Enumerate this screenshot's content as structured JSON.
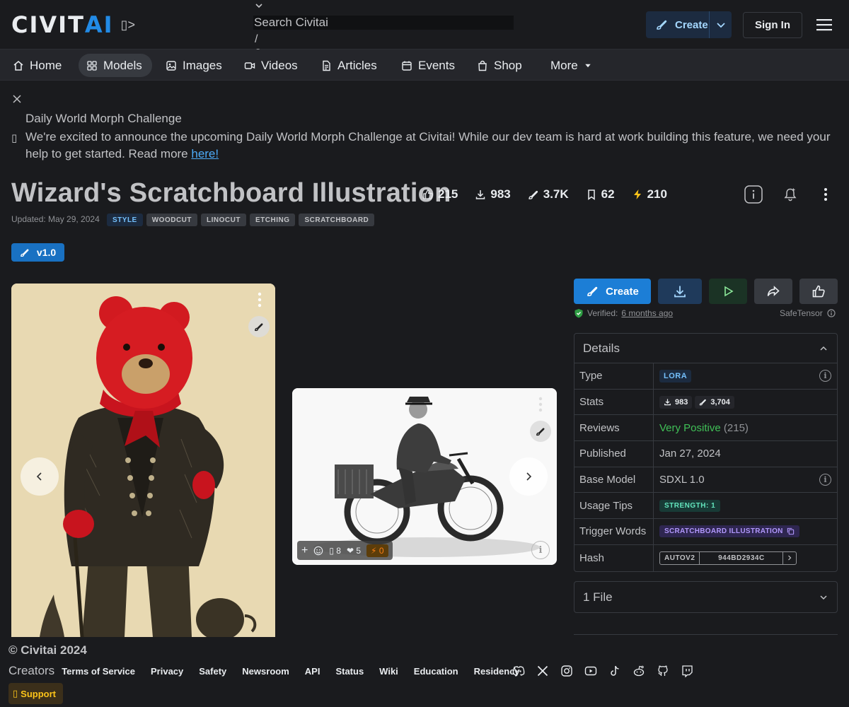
{
  "header": {
    "logo_left": "CIVIT",
    "logo_right": "AI",
    "logo_extra": "▯>",
    "search_placeholder": "Search Civitai",
    "search_hotkey": "/",
    "create_label": "Create",
    "signin_label": "Sign In"
  },
  "nav": {
    "items": [
      {
        "label": "Home",
        "icon": "home-icon"
      },
      {
        "label": "Models",
        "icon": "grid-icon"
      },
      {
        "label": "Images",
        "icon": "image-icon"
      },
      {
        "label": "Videos",
        "icon": "video-icon"
      },
      {
        "label": "Articles",
        "icon": "article-icon"
      },
      {
        "label": "Events",
        "icon": "calendar-icon"
      },
      {
        "label": "Shop",
        "icon": "shopping-bag-icon"
      },
      {
        "label": "More",
        "icon": "caret-down-icon"
      }
    ],
    "active": "Models"
  },
  "announcement": {
    "title": "Daily World Morph Challenge",
    "icon_glyph": "▯",
    "body": "We're excited to announce the upcoming Daily World Morph Challenge at Civitai! While our dev team is hard at work building this feature, we need your help to get started. Read more ",
    "link": "here!"
  },
  "model": {
    "title": "Wizard's Scratchboard Illustration",
    "stats": {
      "likes": "215",
      "downloads": "983",
      "generations": "3.7K",
      "bookmarks": "62",
      "buzz": "210"
    },
    "updated": "Updated: May 29, 2024",
    "tags": [
      "STYLE",
      "WOODCUT",
      "LINOCUT",
      "ETCHING",
      "SCRATCHBOARD"
    ],
    "version": "v1.0"
  },
  "gallery": {
    "card2_reactions": {
      "plus": "+",
      "comments": "8",
      "hearts": "5",
      "buzz": "0"
    }
  },
  "actions": {
    "create_label": "Create",
    "verified_prefix": "Verified:",
    "verified_time": "6 months ago",
    "safetensor": "SafeTensor"
  },
  "details": {
    "header": "Details",
    "type_label": "Type",
    "type_value": "LORA",
    "stats_label": "Stats",
    "stats_downloads": "983",
    "stats_generations": "3,704",
    "reviews_label": "Reviews",
    "reviews_sentiment": "Very Positive",
    "reviews_count": "(215)",
    "published_label": "Published",
    "published_value": "Jan 27, 2024",
    "base_label": "Base Model",
    "base_value": "SDXL 1.0",
    "tips_label": "Usage Tips",
    "tips_value": "STRENGTH: 1",
    "trigger_label": "Trigger Words",
    "trigger_value": "SCRATCHBOARD ILLUSTRATION",
    "hash_label": "Hash",
    "hash_type": "AUTOV2",
    "hash_value": "944BD2934C"
  },
  "files": {
    "label": "1 File"
  },
  "footer": {
    "copyright": "© Civitai 2024",
    "creators": "Creators",
    "links": [
      "Terms of Service",
      "Privacy",
      "Safety",
      "Newsroom",
      "API",
      "Status",
      "Wiki",
      "Education",
      "Residency"
    ],
    "support": "Support",
    "support_glyph": "▯"
  },
  "colors": {
    "accent": "#228be6",
    "background": "#1a1b1e",
    "positive": "#40c057",
    "buzz": "#fcc419"
  }
}
